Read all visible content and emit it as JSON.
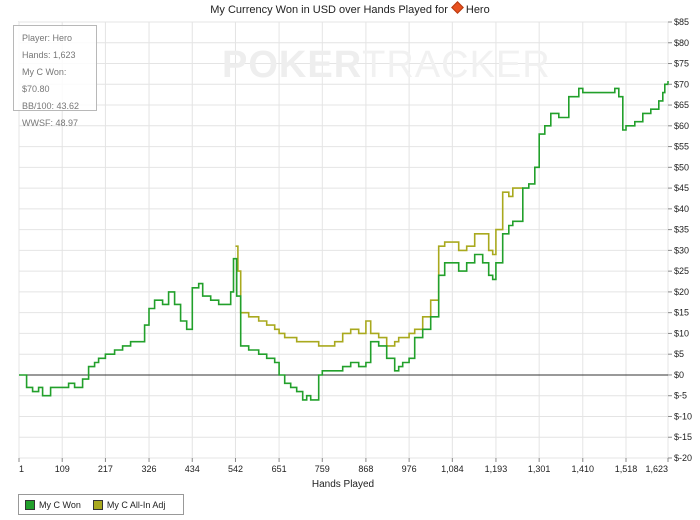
{
  "title": {
    "prefix": "My Currency Won in USD over Hands Played for",
    "player": "Hero"
  },
  "watermark": {
    "bold": "POKER",
    "light": "TRACKER"
  },
  "stats": {
    "player": "Player: Hero",
    "hands": "Hands: 1,623",
    "won": "My C Won: $70.80",
    "bb100": "BB/100: 43.62",
    "wwsf": "WWSF: 48.97"
  },
  "legend": [
    {
      "label": "My C Won",
      "color": "#22a02b"
    },
    {
      "label": "My C All-In Adj",
      "color": "#a9a91e"
    }
  ],
  "chart_data": {
    "type": "line",
    "xlabel": "Hands Played",
    "ylabel": "",
    "xlim": [
      1,
      1623
    ],
    "ylim": [
      -20,
      85
    ],
    "x_ticks": [
      1,
      109,
      217,
      326,
      434,
      542,
      651,
      759,
      868,
      976,
      1084,
      1193,
      1301,
      1410,
      1518,
      1623
    ],
    "x_tick_labels": [
      "1",
      "109",
      "217",
      "326",
      "434",
      "542",
      "651",
      "759",
      "868",
      "976",
      "1,084",
      "1,193",
      "1,301",
      "1,410",
      "1,518",
      "1,623"
    ],
    "y_ticks": [
      -20,
      -15,
      -10,
      -5,
      0,
      5,
      10,
      15,
      20,
      25,
      30,
      35,
      40,
      45,
      50,
      55,
      60,
      65,
      70,
      75,
      80,
      85
    ],
    "y_tick_labels": [
      "$-20",
      "$-15",
      "$-10",
      "$-5",
      "$0",
      "$5",
      "$10",
      "$15",
      "$20",
      "$25",
      "$30",
      "$35",
      "$40",
      "$45",
      "$50",
      "$55",
      "$60",
      "$65",
      "$70",
      "$75",
      "$80",
      "$85"
    ],
    "grid": true,
    "series": [
      {
        "name": "My C Won",
        "color": "#22a02b",
        "x": [
          1,
          20,
          35,
          50,
          60,
          80,
          95,
          109,
          125,
          140,
          160,
          175,
          190,
          200,
          217,
          240,
          260,
          280,
          300,
          315,
          326,
          340,
          360,
          375,
          390,
          405,
          420,
          434,
          450,
          460,
          480,
          500,
          520,
          530,
          537,
          545,
          555,
          575,
          600,
          620,
          640,
          651,
          665,
          680,
          695,
          710,
          720,
          730,
          750,
          759,
          775,
          790,
          810,
          830,
          850,
          868,
          880,
          900,
          920,
          940,
          950,
          960,
          976,
          990,
          1010,
          1030,
          1050,
          1065,
          1075,
          1084,
          1100,
          1120,
          1140,
          1160,
          1175,
          1185,
          1193,
          1210,
          1225,
          1235,
          1260,
          1275,
          1290,
          1301,
          1315,
          1330,
          1350,
          1375,
          1400,
          1410,
          1430,
          1460,
          1490,
          1500,
          1510,
          1518,
          1540,
          1560,
          1580,
          1600,
          1610,
          1615,
          1623
        ],
        "y": [
          0,
          -3,
          -4,
          -3,
          -5,
          -3,
          -3,
          -3,
          -2,
          -3,
          -1,
          2,
          3,
          4,
          5,
          6,
          7,
          8,
          8,
          12,
          16,
          18,
          17,
          20,
          17,
          13,
          11,
          21,
          22,
          19,
          18,
          17,
          17,
          20,
          28,
          19,
          7,
          6,
          5,
          4,
          3,
          0,
          -2,
          -3,
          -4,
          -6,
          -5,
          -6,
          0,
          1,
          1,
          1,
          2,
          3,
          2,
          3,
          8,
          7,
          4,
          1,
          2,
          3,
          4,
          9,
          11,
          14,
          24,
          27,
          27,
          27,
          25,
          27,
          29,
          27,
          24,
          23,
          27,
          34,
          36,
          37,
          45,
          46,
          50,
          58,
          60,
          63,
          62,
          67,
          69,
          68,
          68,
          68,
          69,
          67,
          59,
          60,
          61,
          63,
          64,
          66,
          68,
          70,
          70.8
        ]
      },
      {
        "name": "My C All-In Adj",
        "color": "#a9a91e",
        "x": [
          542,
          548,
          555,
          575,
          600,
          620,
          640,
          651,
          665,
          680,
          695,
          710,
          720,
          730,
          750,
          759,
          775,
          790,
          810,
          830,
          850,
          868,
          880,
          900,
          920,
          940,
          950,
          960,
          976,
          990,
          1010,
          1030,
          1050,
          1065,
          1075,
          1084,
          1100,
          1120,
          1140,
          1160,
          1175,
          1185,
          1193,
          1210,
          1225,
          1235,
          1260
        ],
        "y": [
          31,
          25,
          15,
          14,
          13,
          12,
          11,
          10,
          9,
          9,
          8,
          8,
          8,
          8,
          7,
          7,
          7,
          8,
          10,
          11,
          10,
          13,
          10,
          9,
          7,
          8,
          9,
          9,
          10,
          11,
          14,
          18,
          31,
          32,
          32,
          32,
          30,
          31,
          34,
          34,
          30,
          29,
          35,
          44,
          43,
          45,
          45
        ]
      }
    ]
  }
}
